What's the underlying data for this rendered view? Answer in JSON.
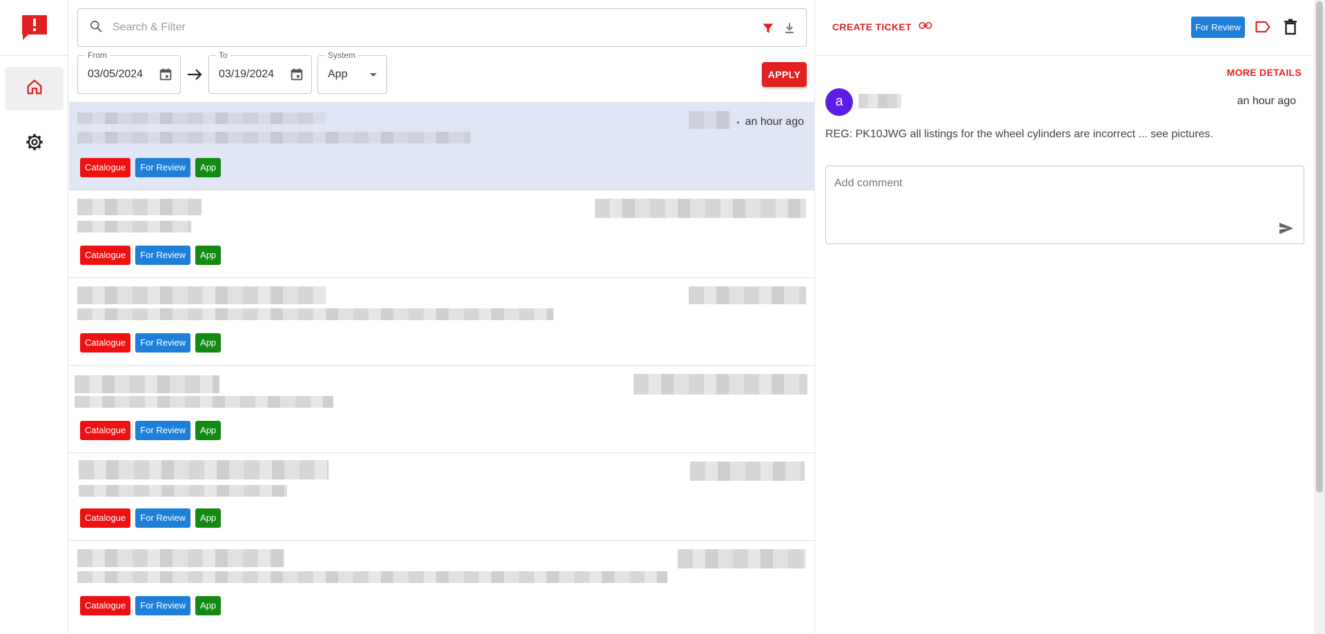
{
  "search": {
    "placeholder": "Search & Filter"
  },
  "filters": {
    "from_label": "From",
    "from_value": "03/05/2024",
    "to_label": "To",
    "to_value": "03/19/2024",
    "system_label": "System",
    "system_value": "App",
    "apply_label": "APPLY"
  },
  "tickets": [
    {
      "time": "an hour ago",
      "chips": [
        "Catalogue",
        "For Review",
        "App"
      ]
    },
    {
      "chips": [
        "Catalogue",
        "For Review",
        "App"
      ]
    },
    {
      "chips": [
        "Catalogue",
        "For Review",
        "App"
      ]
    },
    {
      "chips": [
        "Catalogue",
        "For Review",
        "App"
      ]
    },
    {
      "chips": [
        "Catalogue",
        "For Review",
        "App"
      ]
    },
    {
      "chips": [
        "Catalogue",
        "For Review",
        "App"
      ]
    }
  ],
  "detail": {
    "create_ticket_label": "CREATE TICKET",
    "status": "For Review",
    "more_details_label": "MORE DETAILS",
    "avatar_initial": "a",
    "comment_time": "an hour ago",
    "message": "REG: PK10JWG all listings for the wheel cylinders are incorrect ... see pictures.",
    "comment_placeholder": "Add comment"
  },
  "colors": {
    "brand": "#e12121",
    "chip_catalogue": "#ee1111",
    "chip_review": "#1e7fd8",
    "chip_app": "#138a13",
    "selected_row": "#e1e6f7",
    "avatar": "#5b1ce6"
  },
  "icons": {
    "logo": "alert-chat-icon",
    "home": "home-icon",
    "settings": "gear-icon",
    "search": "search-icon",
    "filter": "filter-icon",
    "download": "download-icon",
    "calendar": "calendar-icon",
    "arrow": "arrow-right-icon",
    "link": "link-icon",
    "label": "label-icon",
    "delete": "trash-icon",
    "send": "send-icon"
  }
}
